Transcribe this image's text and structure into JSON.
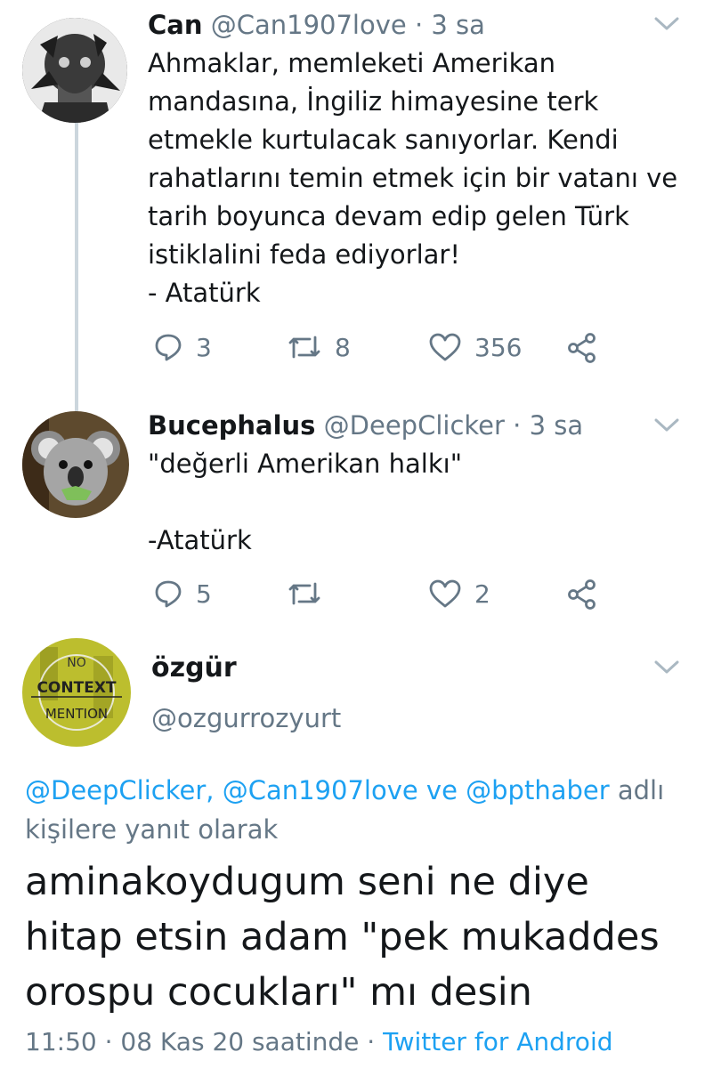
{
  "tweets": [
    {
      "name": "Can",
      "handle": "@Can1907love",
      "time": "· 3 sa",
      "text": "Ahmaklar, memleketi Amerikan\nmandasına, İngiliz himayesine terk\netmekle kurtulacak sanıyorlar. Kendi\nrahatlarını temin etmek için bir vatanı ve\ntarih boyunca devam edip gelen Türk\nistiklalini feda ediyorlar!\n- Atatürk",
      "replies": "3",
      "retweets": "8",
      "likes": "356"
    },
    {
      "name": "Bucephalus",
      "handle": "@DeepClicker",
      "time": "· 3 sa",
      "text": "\"değerli Amerikan halkı\"\n\n-Atatürk",
      "replies": "5",
      "retweets": "",
      "likes": "2"
    }
  ],
  "main_tweet": {
    "name": "özgür",
    "handle": "@ozgurrozyurt",
    "avatar_text_top": "CONTEXT",
    "avatar_text_bottom": "MENTION",
    "avatar_text_no": "NO",
    "reply_mentions": "@DeepClicker, @Can1907love ve @bpthaber",
    "reply_suffix": "adlı kişilere yanıt olarak",
    "text": "aminakoydugum seni ne diye\nhitap etsin adam \"pek mukaddes\norospu cocukları\" mı desin",
    "timestamp": "11:50 · 08 Kas 20 saatinde ·",
    "source": "Twitter for Android"
  },
  "colors": {
    "text": "#14171a",
    "secondary": "#657786",
    "link": "#1da1f2",
    "thread_line": "#ccd6dd"
  },
  "icons": [
    "reply-icon",
    "retweet-icon",
    "like-icon",
    "share-icon",
    "chevron-down-icon"
  ]
}
